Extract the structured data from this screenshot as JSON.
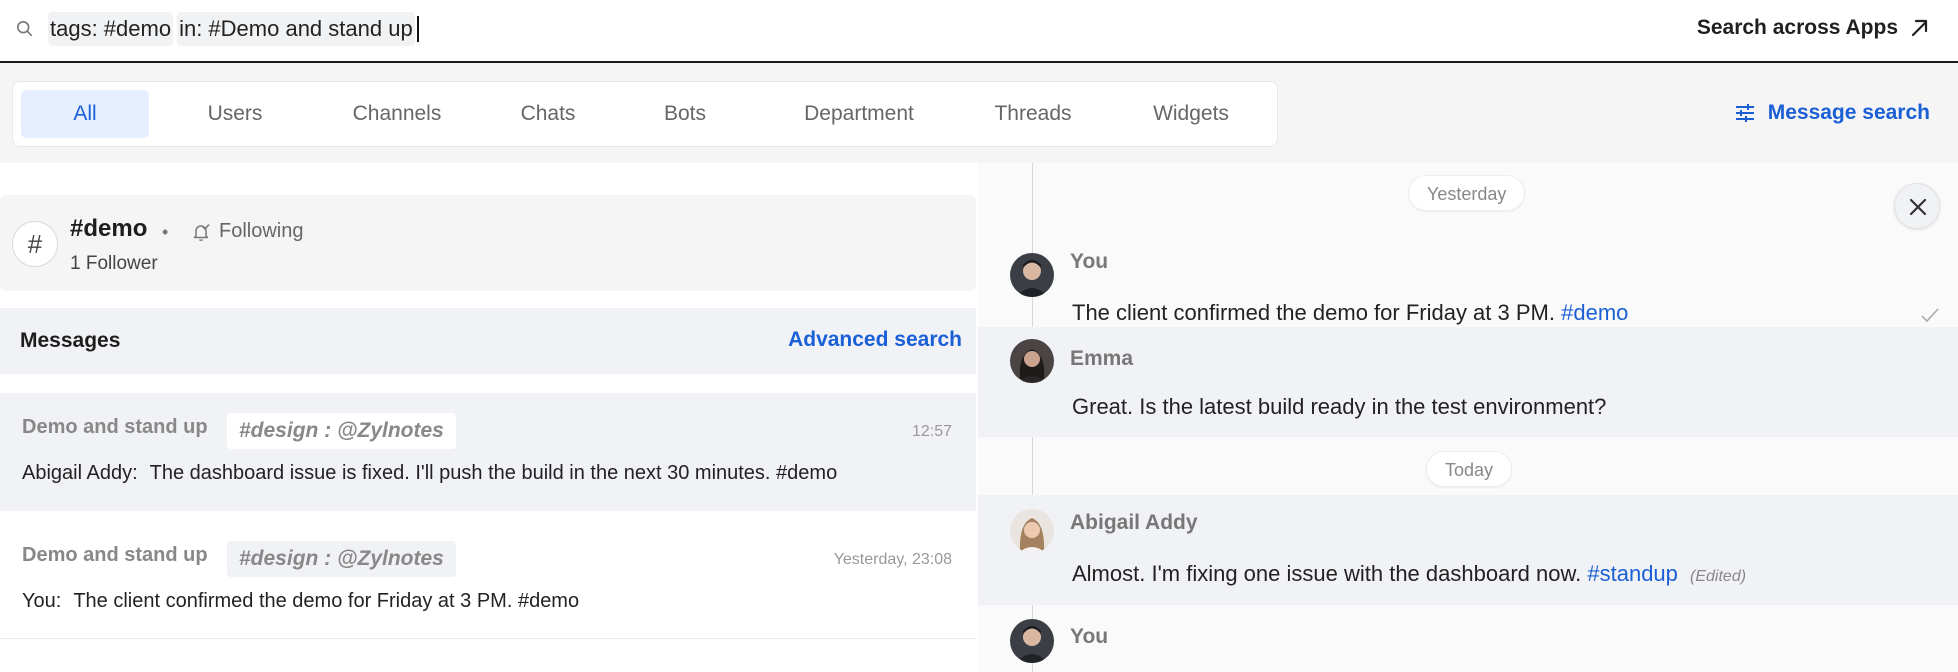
{
  "search": {
    "tag_chip": "tags: #demo",
    "in_chip": "in: #Demo and stand up",
    "apps_label": "Search across Apps"
  },
  "tabs": [
    {
      "label": "All",
      "active": true
    },
    {
      "label": "Users"
    },
    {
      "label": "Channels"
    },
    {
      "label": "Chats"
    },
    {
      "label": "Bots"
    },
    {
      "label": "Department"
    },
    {
      "label": "Threads"
    },
    {
      "label": "Widgets"
    }
  ],
  "message_search_label": "Message search",
  "channel": {
    "name": "#demo",
    "dot": "•",
    "following": "Following",
    "followers": "1 Follower",
    "icon": "#"
  },
  "messages_section": {
    "title": "Messages",
    "advanced": "Advanced search"
  },
  "results": [
    {
      "title": "Demo and stand up",
      "tag": "#design : @Zylnotes",
      "time": "12:57",
      "sender": "Abigail Addy:",
      "text": "The dashboard issue is fixed. I'll push the build in the next 30 minutes. #demo"
    },
    {
      "title": "Demo and stand up",
      "tag": "#design : @Zylnotes",
      "time": "Yesterday, 23:08",
      "sender": "You:",
      "text": "The client confirmed the demo for Friday at 3 PM. #demo"
    }
  ],
  "thread": {
    "day1": "Yesterday",
    "day2": "Today",
    "messages": [
      {
        "author": "You",
        "text": "The client confirmed the demo for Friday at 3 PM.",
        "tag": "#demo"
      },
      {
        "author": "Emma",
        "text": "Great. Is the latest build ready in the test environment?"
      },
      {
        "author": "Abigail Addy",
        "text": "Almost. I'm fixing one issue with the dashboard now.",
        "tag": "#standup",
        "edited": "(Edited)"
      },
      {
        "author": "You"
      }
    ]
  },
  "colors": {
    "accent": "#1a5fd6",
    "active_tab_bg": "#e6efff",
    "highlight_row": "#f1f2f5"
  }
}
